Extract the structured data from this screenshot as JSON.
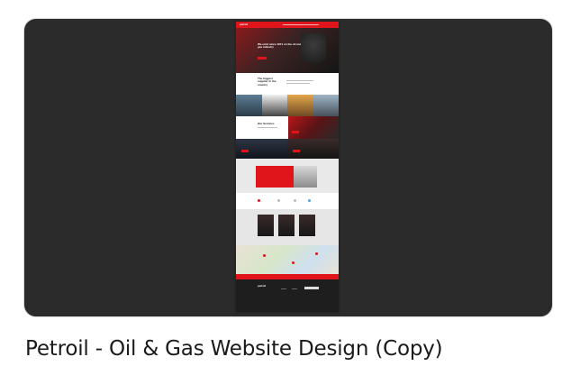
{
  "caption": "Petroil - Oil & Gas Website Design (Copy)",
  "thumb": {
    "logo": "petroil",
    "hero_text": "We exist since 1971 on the oil and gas industry",
    "intro_heading": "The biggest supplier in the country",
    "services_heading": "Our Services",
    "footer_logo": "petroil"
  },
  "colors": {
    "brand_red": "#e0151b",
    "card_bg": "#2b2b2b",
    "footer_bg": "#1e1e1e"
  }
}
